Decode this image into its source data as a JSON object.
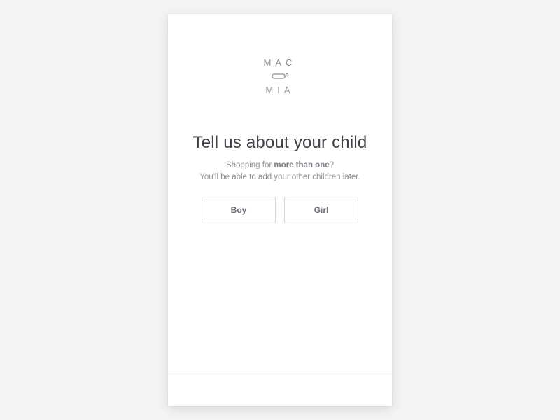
{
  "logo": {
    "line1": "MAC",
    "line2": "MIA"
  },
  "heading": "Tell us about your child",
  "subtext": {
    "prefix": "Shopping for ",
    "emphasis": "more than one",
    "suffix": "?",
    "line2": "You'll be able to add your other children later."
  },
  "options": {
    "boy": "Boy",
    "girl": "Girl"
  }
}
